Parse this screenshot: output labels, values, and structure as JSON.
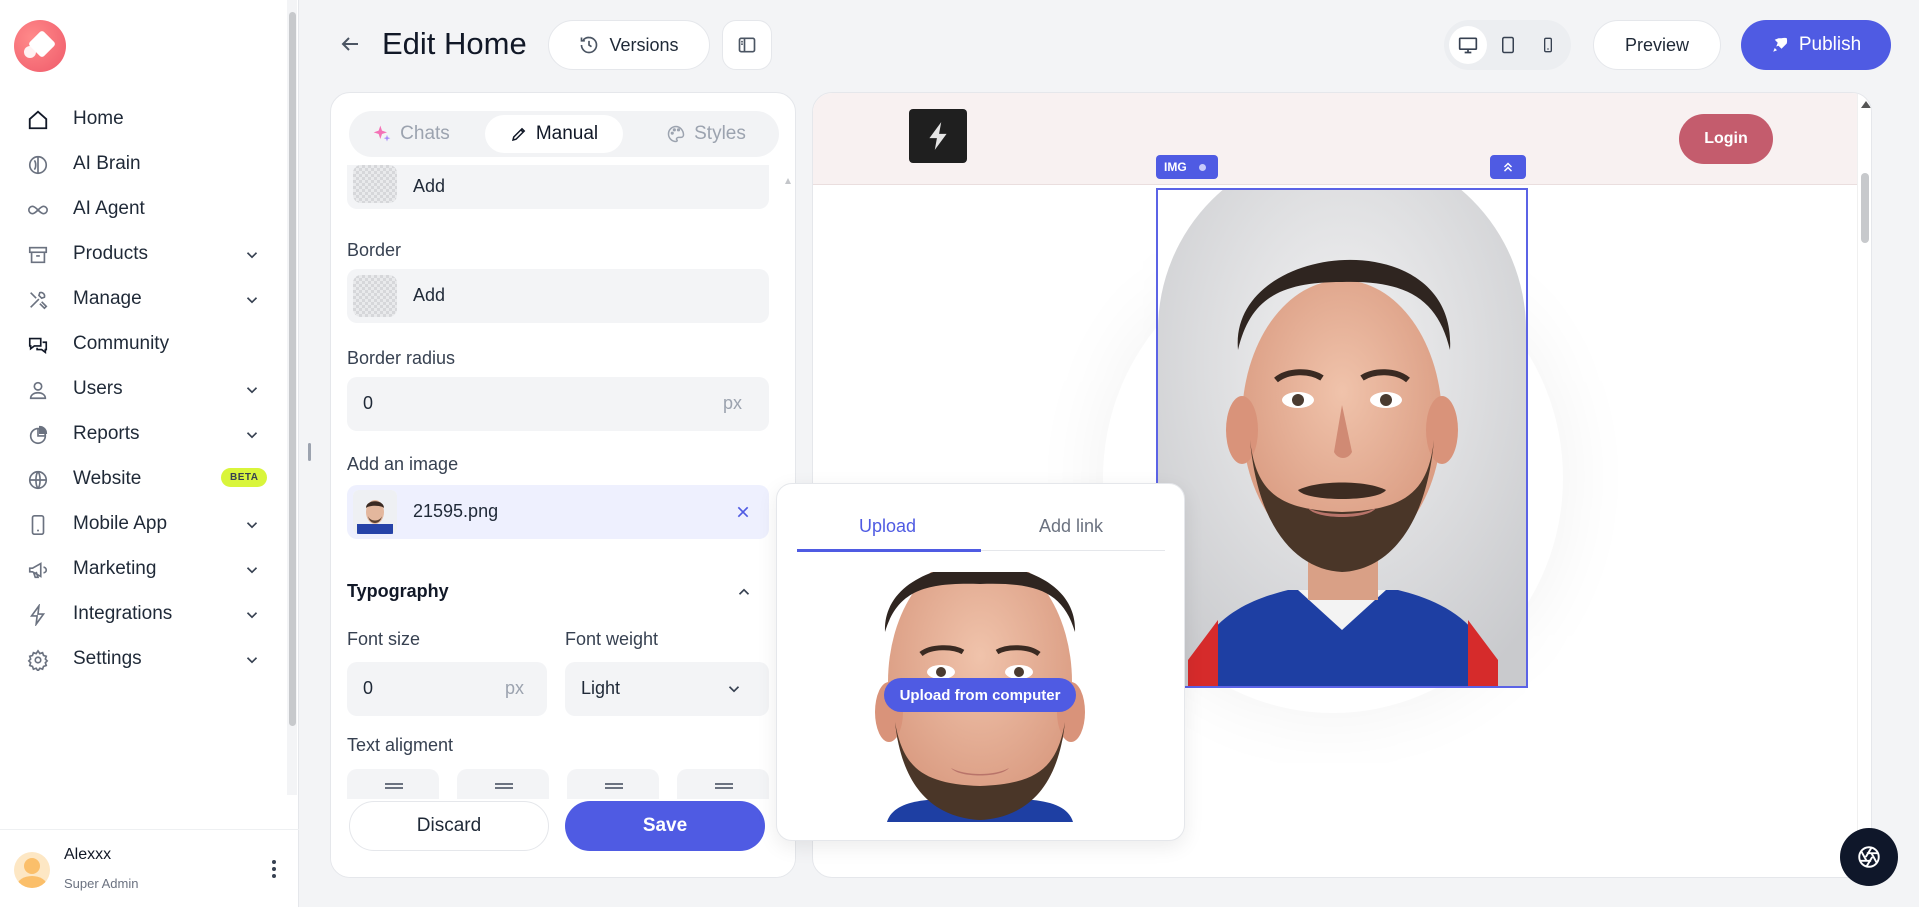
{
  "sidebar": {
    "items": [
      {
        "label": "Home",
        "icon": "home-icon",
        "expandable": false
      },
      {
        "label": "AI Brain",
        "icon": "brain-icon",
        "expandable": false
      },
      {
        "label": "AI Agent",
        "icon": "infinity-icon",
        "expandable": false
      },
      {
        "label": "Products",
        "icon": "archive-box-icon",
        "expandable": true
      },
      {
        "label": "Manage",
        "icon": "tools-icon",
        "expandable": true
      },
      {
        "label": "Community",
        "icon": "chat-bubbles-icon",
        "expandable": false
      },
      {
        "label": "Users",
        "icon": "user-icon",
        "expandable": true
      },
      {
        "label": "Reports",
        "icon": "pie-chart-icon",
        "expandable": true
      },
      {
        "label": "Website",
        "icon": "globe-icon",
        "expandable": false,
        "badge": "BETA"
      },
      {
        "label": "Mobile App",
        "icon": "phone-icon",
        "expandable": true
      },
      {
        "label": "Marketing",
        "icon": "megaphone-icon",
        "expandable": true
      },
      {
        "label": "Integrations",
        "icon": "bolt-icon",
        "expandable": true
      },
      {
        "label": "Settings",
        "icon": "gear-icon",
        "expandable": true
      }
    ],
    "user": {
      "name": "Alexxx",
      "role": "Super Admin"
    }
  },
  "header": {
    "title": "Edit Home",
    "versions_label": "Versions",
    "preview_label": "Preview",
    "publish_label": "Publish",
    "active_device": "desktop"
  },
  "editor": {
    "tabs": [
      {
        "label": "Chats",
        "icon": "sparkle-icon",
        "active": false
      },
      {
        "label": "Manual",
        "icon": "pencil-icon",
        "active": true
      },
      {
        "label": "Styles",
        "icon": "palette-icon",
        "active": false
      }
    ],
    "background_add_label": "Add",
    "border_label": "Border",
    "border_add_label": "Add",
    "border_radius_label": "Border radius",
    "border_radius_value": "0",
    "border_radius_unit": "px",
    "image_label": "Add an image",
    "image_filename": "21595.png",
    "typography_label": "Typography",
    "font_size_label": "Font size",
    "font_size_value": "0",
    "font_size_unit": "px",
    "font_weight_label": "Font weight",
    "font_weight_value": "Light",
    "text_alignment_label": "Text aligment",
    "discard_label": "Discard",
    "save_label": "Save"
  },
  "canvas": {
    "login_label": "Login",
    "img_tag_label": "IMG"
  },
  "upload_popup": {
    "tabs": [
      {
        "label": "Upload",
        "active": true
      },
      {
        "label": "Add link",
        "active": false
      }
    ],
    "upload_button_label": "Upload from computer"
  },
  "colors": {
    "accent": "#4f5be3",
    "login": "#c45c6d",
    "beta_badge": "#d9f53b"
  }
}
